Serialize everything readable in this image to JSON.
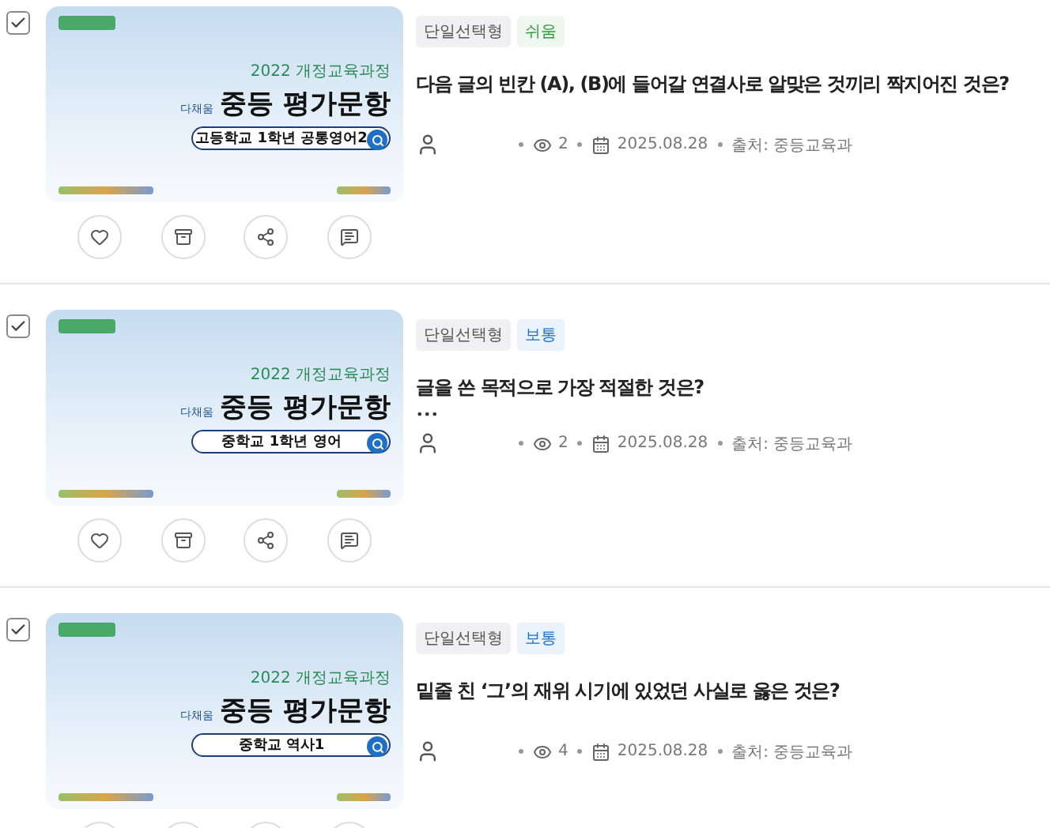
{
  "items": [
    {
      "checked": true,
      "thumbnail": {
        "curriculum": "2022 개정교육과정",
        "brand": "다채움",
        "title": "중등 평가문항",
        "subject": "고등학교 1학년 공통영어2"
      },
      "type_tag": "단일선택형",
      "difficulty": {
        "label": "쉬움",
        "kind": "easy"
      },
      "question": "다음 글의 빈칸 (A), (B)에 들어갈 연결사로 알맞은 것끼리 짝지어진 것은?",
      "views": "2",
      "date": "2025.08.28",
      "source": "출처: 중등교육과"
    },
    {
      "checked": true,
      "thumbnail": {
        "curriculum": "2022 개정교육과정",
        "brand": "다채움",
        "title": "중등 평가문항",
        "subject": "중학교 1학년 영어"
      },
      "type_tag": "단일선택형",
      "difficulty": {
        "label": "보통",
        "kind": "normal"
      },
      "question": "글을 쓴 목적으로 가장 적절한 것은?",
      "more": "•••",
      "views": "2",
      "date": "2025.08.28",
      "source": "출처: 중등교육과"
    },
    {
      "checked": true,
      "thumbnail": {
        "curriculum": "2022 개정교육과정",
        "brand": "다채움",
        "title": "중등 평가문항",
        "subject": "중학교 역사1"
      },
      "type_tag": "단일선택형",
      "difficulty": {
        "label": "보통",
        "kind": "normal"
      },
      "question": "밑줄 친 ‘그’의 재위 시기에 있었던 사실로 옳은 것은?",
      "views": "4",
      "date": "2025.08.28",
      "source": "출처: 중등교육과"
    }
  ]
}
